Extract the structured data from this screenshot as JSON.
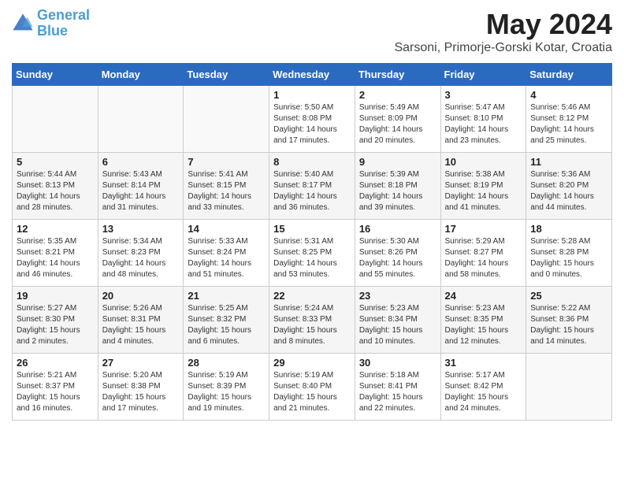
{
  "header": {
    "logo_line1": "General",
    "logo_line2": "Blue",
    "month": "May 2024",
    "location": "Sarsoni, Primorje-Gorski Kotar, Croatia"
  },
  "days_of_week": [
    "Sunday",
    "Monday",
    "Tuesday",
    "Wednesday",
    "Thursday",
    "Friday",
    "Saturday"
  ],
  "weeks": [
    [
      {
        "day": "",
        "info": ""
      },
      {
        "day": "",
        "info": ""
      },
      {
        "day": "",
        "info": ""
      },
      {
        "day": "1",
        "info": "Sunrise: 5:50 AM\nSunset: 8:08 PM\nDaylight: 14 hours\nand 17 minutes."
      },
      {
        "day": "2",
        "info": "Sunrise: 5:49 AM\nSunset: 8:09 PM\nDaylight: 14 hours\nand 20 minutes."
      },
      {
        "day": "3",
        "info": "Sunrise: 5:47 AM\nSunset: 8:10 PM\nDaylight: 14 hours\nand 23 minutes."
      },
      {
        "day": "4",
        "info": "Sunrise: 5:46 AM\nSunset: 8:12 PM\nDaylight: 14 hours\nand 25 minutes."
      }
    ],
    [
      {
        "day": "5",
        "info": "Sunrise: 5:44 AM\nSunset: 8:13 PM\nDaylight: 14 hours\nand 28 minutes."
      },
      {
        "day": "6",
        "info": "Sunrise: 5:43 AM\nSunset: 8:14 PM\nDaylight: 14 hours\nand 31 minutes."
      },
      {
        "day": "7",
        "info": "Sunrise: 5:41 AM\nSunset: 8:15 PM\nDaylight: 14 hours\nand 33 minutes."
      },
      {
        "day": "8",
        "info": "Sunrise: 5:40 AM\nSunset: 8:17 PM\nDaylight: 14 hours\nand 36 minutes."
      },
      {
        "day": "9",
        "info": "Sunrise: 5:39 AM\nSunset: 8:18 PM\nDaylight: 14 hours\nand 39 minutes."
      },
      {
        "day": "10",
        "info": "Sunrise: 5:38 AM\nSunset: 8:19 PM\nDaylight: 14 hours\nand 41 minutes."
      },
      {
        "day": "11",
        "info": "Sunrise: 5:36 AM\nSunset: 8:20 PM\nDaylight: 14 hours\nand 44 minutes."
      }
    ],
    [
      {
        "day": "12",
        "info": "Sunrise: 5:35 AM\nSunset: 8:21 PM\nDaylight: 14 hours\nand 46 minutes."
      },
      {
        "day": "13",
        "info": "Sunrise: 5:34 AM\nSunset: 8:23 PM\nDaylight: 14 hours\nand 48 minutes."
      },
      {
        "day": "14",
        "info": "Sunrise: 5:33 AM\nSunset: 8:24 PM\nDaylight: 14 hours\nand 51 minutes."
      },
      {
        "day": "15",
        "info": "Sunrise: 5:31 AM\nSunset: 8:25 PM\nDaylight: 14 hours\nand 53 minutes."
      },
      {
        "day": "16",
        "info": "Sunrise: 5:30 AM\nSunset: 8:26 PM\nDaylight: 14 hours\nand 55 minutes."
      },
      {
        "day": "17",
        "info": "Sunrise: 5:29 AM\nSunset: 8:27 PM\nDaylight: 14 hours\nand 58 minutes."
      },
      {
        "day": "18",
        "info": "Sunrise: 5:28 AM\nSunset: 8:28 PM\nDaylight: 15 hours\nand 0 minutes."
      }
    ],
    [
      {
        "day": "19",
        "info": "Sunrise: 5:27 AM\nSunset: 8:30 PM\nDaylight: 15 hours\nand 2 minutes."
      },
      {
        "day": "20",
        "info": "Sunrise: 5:26 AM\nSunset: 8:31 PM\nDaylight: 15 hours\nand 4 minutes."
      },
      {
        "day": "21",
        "info": "Sunrise: 5:25 AM\nSunset: 8:32 PM\nDaylight: 15 hours\nand 6 minutes."
      },
      {
        "day": "22",
        "info": "Sunrise: 5:24 AM\nSunset: 8:33 PM\nDaylight: 15 hours\nand 8 minutes."
      },
      {
        "day": "23",
        "info": "Sunrise: 5:23 AM\nSunset: 8:34 PM\nDaylight: 15 hours\nand 10 minutes."
      },
      {
        "day": "24",
        "info": "Sunrise: 5:23 AM\nSunset: 8:35 PM\nDaylight: 15 hours\nand 12 minutes."
      },
      {
        "day": "25",
        "info": "Sunrise: 5:22 AM\nSunset: 8:36 PM\nDaylight: 15 hours\nand 14 minutes."
      }
    ],
    [
      {
        "day": "26",
        "info": "Sunrise: 5:21 AM\nSunset: 8:37 PM\nDaylight: 15 hours\nand 16 minutes."
      },
      {
        "day": "27",
        "info": "Sunrise: 5:20 AM\nSunset: 8:38 PM\nDaylight: 15 hours\nand 17 minutes."
      },
      {
        "day": "28",
        "info": "Sunrise: 5:19 AM\nSunset: 8:39 PM\nDaylight: 15 hours\nand 19 minutes."
      },
      {
        "day": "29",
        "info": "Sunrise: 5:19 AM\nSunset: 8:40 PM\nDaylight: 15 hours\nand 21 minutes."
      },
      {
        "day": "30",
        "info": "Sunrise: 5:18 AM\nSunset: 8:41 PM\nDaylight: 15 hours\nand 22 minutes."
      },
      {
        "day": "31",
        "info": "Sunrise: 5:17 AM\nSunset: 8:42 PM\nDaylight: 15 hours\nand 24 minutes."
      },
      {
        "day": "",
        "info": ""
      }
    ]
  ]
}
